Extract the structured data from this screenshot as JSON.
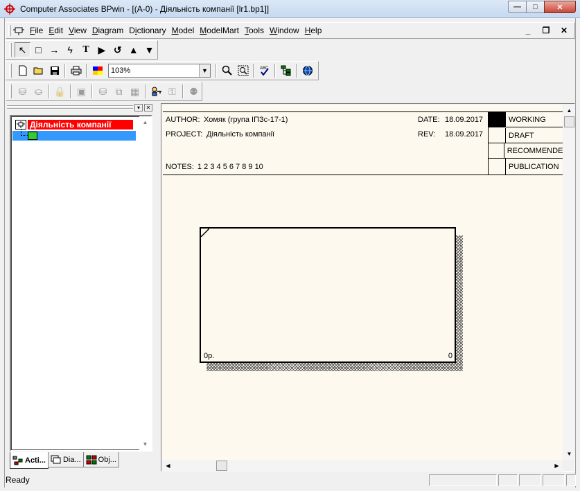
{
  "window": {
    "title": "Computer Associates BPwin - [(A-0)  - Діяльність компанії  [lr1.bp1]]",
    "minimize": "—",
    "maximize": "□",
    "close": "✕"
  },
  "menubar": {
    "items": [
      {
        "label": "File",
        "key": "F"
      },
      {
        "label": "Edit",
        "key": "E"
      },
      {
        "label": "View",
        "key": "V"
      },
      {
        "label": "Diagram",
        "key": "D"
      },
      {
        "label": "Dictionary",
        "key": "i"
      },
      {
        "label": "Model",
        "key": "M"
      },
      {
        "label": "ModelMart",
        "key": "M"
      },
      {
        "label": "Tools",
        "key": "T"
      },
      {
        "label": "Window",
        "key": "W"
      },
      {
        "label": "Help",
        "key": "H"
      }
    ],
    "mdi_minimize": "_",
    "mdi_restore": "❐",
    "mdi_close": "✕"
  },
  "toolbars": {
    "palette": [
      "pointer-tool",
      "activity-box-tool",
      "arrow-tool",
      "squiggle-tool",
      "text-tool",
      "go-to-sibling",
      "go-to-parent",
      "go-up",
      "go-down"
    ],
    "palette_glyphs": [
      "↖",
      "□",
      "→",
      "ϟ",
      "T",
      "▶",
      "↺",
      "▲",
      "▼"
    ],
    "standard_zoom": "103%"
  },
  "explorer": {
    "root_label": "Діяльність компанії",
    "tabs": [
      {
        "label": "Acti...",
        "active": true
      },
      {
        "label": "Dia...",
        "active": false
      },
      {
        "label": "Obj...",
        "active": false
      }
    ]
  },
  "diagram": {
    "author_label": "AUTHOR:",
    "author": "Хомяк (група ІПЗс-17-1)",
    "project_label": "PROJECT:",
    "project": "Діяльність компанії",
    "notes_label": "NOTES:",
    "notes": "1  2  3  4  5  6  7  8  9  10",
    "date_label": "DATE:",
    "date": "18.09.2017",
    "rev_label": "REV:",
    "rev": "18.09.2017",
    "status": [
      "WORKING",
      "DRAFT",
      "RECOMMENDED",
      "PUBLICATION"
    ],
    "status_active": "WORKING",
    "activity": {
      "cost": "0р.",
      "number": "0"
    }
  },
  "statusbar": {
    "text": "Ready"
  }
}
